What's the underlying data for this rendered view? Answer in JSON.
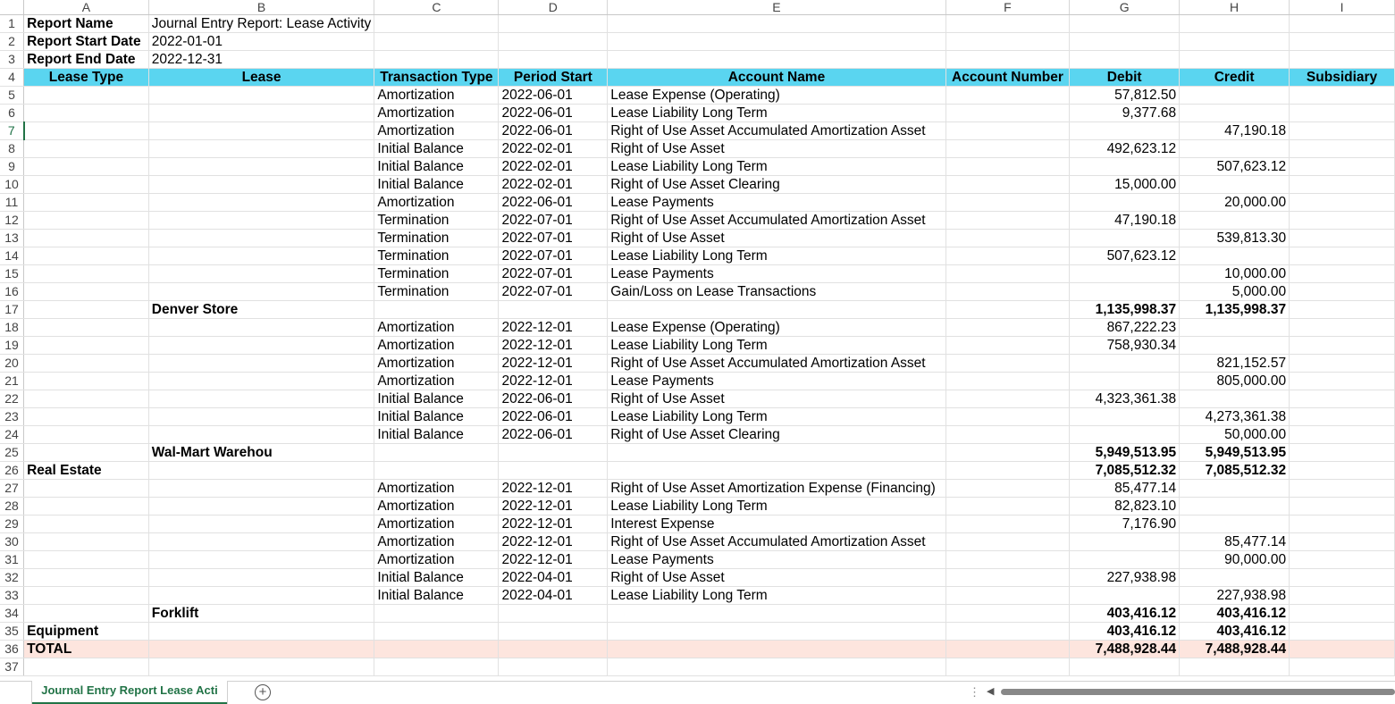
{
  "columns": [
    "A",
    "B",
    "C",
    "D",
    "E",
    "F",
    "G",
    "H",
    "I"
  ],
  "rows": [
    {
      "n": "1",
      "kind": "meta",
      "cells": [
        "Report Name",
        "Journal Entry Report: Lease Activity",
        "",
        "",
        "",
        "",
        "",
        "",
        ""
      ]
    },
    {
      "n": "2",
      "kind": "meta",
      "cells": [
        "Report Start Date",
        "2022-01-01",
        "",
        "",
        "",
        "",
        "",
        "",
        ""
      ]
    },
    {
      "n": "3",
      "kind": "meta",
      "cells": [
        "Report End Date",
        "2022-12-31",
        "",
        "",
        "",
        "",
        "",
        "",
        ""
      ]
    },
    {
      "n": "4",
      "kind": "hdr",
      "cells": [
        "Lease Type",
        "Lease",
        "Transaction Type",
        "Period Start",
        "Account Name",
        "Account Number",
        "Debit",
        "Credit",
        "Subsidiary"
      ]
    },
    {
      "n": "5",
      "kind": "data",
      "cells": [
        "",
        "",
        "Amortization",
        "2022-06-01",
        "Lease Expense (Operating)",
        "",
        "57,812.50",
        "",
        ""
      ]
    },
    {
      "n": "6",
      "kind": "data",
      "cells": [
        "",
        "",
        "Amortization",
        "2022-06-01",
        "Lease Liability Long Term",
        "",
        "9,377.68",
        "",
        ""
      ]
    },
    {
      "n": "7",
      "kind": "data",
      "cells": [
        "",
        "",
        "Amortization",
        "2022-06-01",
        "Right of Use Asset Accumulated Amortization Asset",
        "",
        "",
        "47,190.18",
        ""
      ]
    },
    {
      "n": "8",
      "kind": "data",
      "cells": [
        "",
        "",
        "Initial Balance",
        "2022-02-01",
        "Right of Use Asset",
        "",
        "492,623.12",
        "",
        ""
      ]
    },
    {
      "n": "9",
      "kind": "data",
      "cells": [
        "",
        "",
        "Initial Balance",
        "2022-02-01",
        "Lease Liability Long Term",
        "",
        "",
        "507,623.12",
        ""
      ]
    },
    {
      "n": "10",
      "kind": "data",
      "cells": [
        "",
        "",
        "Initial Balance",
        "2022-02-01",
        "Right of Use Asset Clearing",
        "",
        "15,000.00",
        "",
        ""
      ]
    },
    {
      "n": "11",
      "kind": "data",
      "cells": [
        "",
        "",
        "Amortization",
        "2022-06-01",
        "Lease Payments",
        "",
        "",
        "20,000.00",
        ""
      ]
    },
    {
      "n": "12",
      "kind": "data",
      "cells": [
        "",
        "",
        "Termination",
        "2022-07-01",
        "Right of Use Asset Accumulated Amortization Asset",
        "",
        "47,190.18",
        "",
        ""
      ]
    },
    {
      "n": "13",
      "kind": "data",
      "cells": [
        "",
        "",
        "Termination",
        "2022-07-01",
        "Right of Use Asset",
        "",
        "",
        "539,813.30",
        ""
      ]
    },
    {
      "n": "14",
      "kind": "data",
      "cells": [
        "",
        "",
        "Termination",
        "2022-07-01",
        "Lease Liability Long Term",
        "",
        "507,623.12",
        "",
        ""
      ]
    },
    {
      "n": "15",
      "kind": "data",
      "cells": [
        "",
        "",
        "Termination",
        "2022-07-01",
        "Lease Payments",
        "",
        "",
        "10,000.00",
        ""
      ]
    },
    {
      "n": "16",
      "kind": "data",
      "cells": [
        "",
        "",
        "Termination",
        "2022-07-01",
        "Gain/Loss on Lease Transactions",
        "",
        "",
        "5,000.00",
        ""
      ]
    },
    {
      "n": "17",
      "kind": "subtotal",
      "cells": [
        "",
        "Denver Store",
        "",
        "",
        "",
        "",
        "1,135,998.37",
        "1,135,998.37",
        ""
      ]
    },
    {
      "n": "18",
      "kind": "data",
      "cells": [
        "",
        "",
        "Amortization",
        "2022-12-01",
        "Lease Expense (Operating)",
        "",
        "867,222.23",
        "",
        ""
      ]
    },
    {
      "n": "19",
      "kind": "data",
      "cells": [
        "",
        "",
        "Amortization",
        "2022-12-01",
        "Lease Liability Long Term",
        "",
        "758,930.34",
        "",
        ""
      ]
    },
    {
      "n": "20",
      "kind": "data",
      "cells": [
        "",
        "",
        "Amortization",
        "2022-12-01",
        "Right of Use Asset Accumulated Amortization Asset",
        "",
        "",
        "821,152.57",
        ""
      ]
    },
    {
      "n": "21",
      "kind": "data",
      "cells": [
        "",
        "",
        "Amortization",
        "2022-12-01",
        "Lease Payments",
        "",
        "",
        "805,000.00",
        ""
      ]
    },
    {
      "n": "22",
      "kind": "data",
      "cells": [
        "",
        "",
        "Initial Balance",
        "2022-06-01",
        "Right of Use Asset",
        "",
        "4,323,361.38",
        "",
        ""
      ]
    },
    {
      "n": "23",
      "kind": "data",
      "cells": [
        "",
        "",
        "Initial Balance",
        "2022-06-01",
        "Lease Liability Long Term",
        "",
        "",
        "4,273,361.38",
        ""
      ]
    },
    {
      "n": "24",
      "kind": "data",
      "cells": [
        "",
        "",
        "Initial Balance",
        "2022-06-01",
        "Right of Use Asset Clearing",
        "",
        "",
        "50,000.00",
        ""
      ]
    },
    {
      "n": "25",
      "kind": "subtotal",
      "cells": [
        "",
        "Wal-Mart Warehou",
        "",
        "",
        "",
        "",
        "5,949,513.95",
        "5,949,513.95",
        ""
      ]
    },
    {
      "n": "26",
      "kind": "group",
      "cells": [
        "Real Estate",
        "",
        "",
        "",
        "",
        "",
        "7,085,512.32",
        "7,085,512.32",
        ""
      ]
    },
    {
      "n": "27",
      "kind": "data",
      "cells": [
        "",
        "",
        "Amortization",
        "2022-12-01",
        "Right of Use Asset Amortization Expense (Financing)",
        "",
        "85,477.14",
        "",
        ""
      ]
    },
    {
      "n": "28",
      "kind": "data",
      "cells": [
        "",
        "",
        "Amortization",
        "2022-12-01",
        "Lease Liability Long Term",
        "",
        "82,823.10",
        "",
        ""
      ]
    },
    {
      "n": "29",
      "kind": "data",
      "cells": [
        "",
        "",
        "Amortization",
        "2022-12-01",
        "Interest Expense",
        "",
        "7,176.90",
        "",
        ""
      ]
    },
    {
      "n": "30",
      "kind": "data",
      "cells": [
        "",
        "",
        "Amortization",
        "2022-12-01",
        "Right of Use Asset Accumulated Amortization Asset",
        "",
        "",
        "85,477.14",
        ""
      ]
    },
    {
      "n": "31",
      "kind": "data",
      "cells": [
        "",
        "",
        "Amortization",
        "2022-12-01",
        "Lease Payments",
        "",
        "",
        "90,000.00",
        ""
      ]
    },
    {
      "n": "32",
      "kind": "data",
      "cells": [
        "",
        "",
        "Initial Balance",
        "2022-04-01",
        "Right of Use Asset",
        "",
        "227,938.98",
        "",
        ""
      ]
    },
    {
      "n": "33",
      "kind": "data",
      "cells": [
        "",
        "",
        "Initial Balance",
        "2022-04-01",
        "Lease Liability Long Term",
        "",
        "",
        "227,938.98",
        ""
      ]
    },
    {
      "n": "34",
      "kind": "subtotal",
      "cells": [
        "",
        "Forklift",
        "",
        "",
        "",
        "",
        "403,416.12",
        "403,416.12",
        ""
      ]
    },
    {
      "n": "35",
      "kind": "group",
      "cells": [
        "Equipment",
        "",
        "",
        "",
        "",
        "",
        "403,416.12",
        "403,416.12",
        ""
      ]
    },
    {
      "n": "36",
      "kind": "total",
      "cells": [
        "TOTAL",
        "",
        "",
        "",
        "",
        "",
        "7,488,928.44",
        "7,488,928.44",
        ""
      ]
    },
    {
      "n": "37",
      "kind": "empty",
      "cells": [
        "",
        "",
        "",
        "",
        "",
        "",
        "",
        "",
        ""
      ]
    }
  ],
  "active_row": "7",
  "sheet_tab": {
    "label": "Journal Entry Report Lease Acti"
  },
  "add_sheet_label": "+",
  "colors": {
    "header": "#5ad5f0",
    "group": "#dff4fb",
    "total": "#fde5de",
    "accent": "#217346"
  },
  "icons": {
    "add_sheet": "plus-circle-icon",
    "tab_menu": "vertical-dots-icon",
    "scroll_left": "left-arrow-icon"
  }
}
